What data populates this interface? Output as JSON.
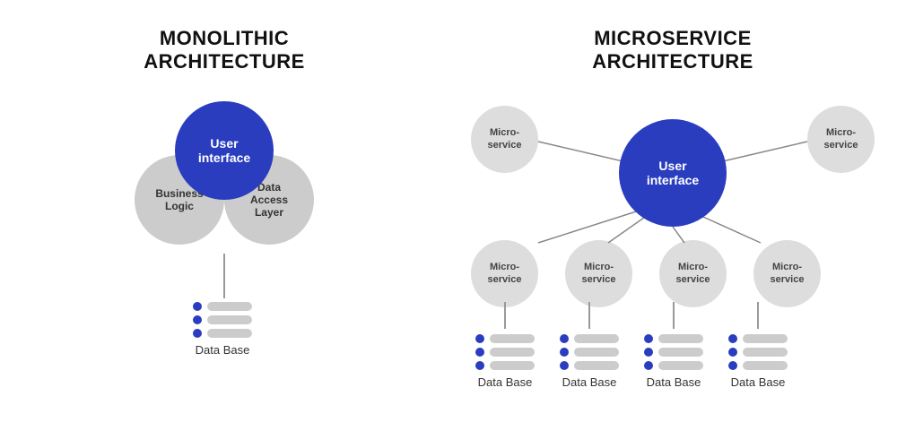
{
  "monolithic": {
    "title": "MONOLITHIC\nARCHITECTURE",
    "ui_label": "User\ninterface",
    "business_label": "Business\nLogic",
    "dal_label": "Data\nAccess\nLayer",
    "db_label": "Data Base"
  },
  "microservice": {
    "title": "MICROSERVICE\nARCHITECTURE",
    "ui_label": "User\ninterface",
    "ms_label": "Micro-\nservice",
    "db_label": "Data Base"
  }
}
